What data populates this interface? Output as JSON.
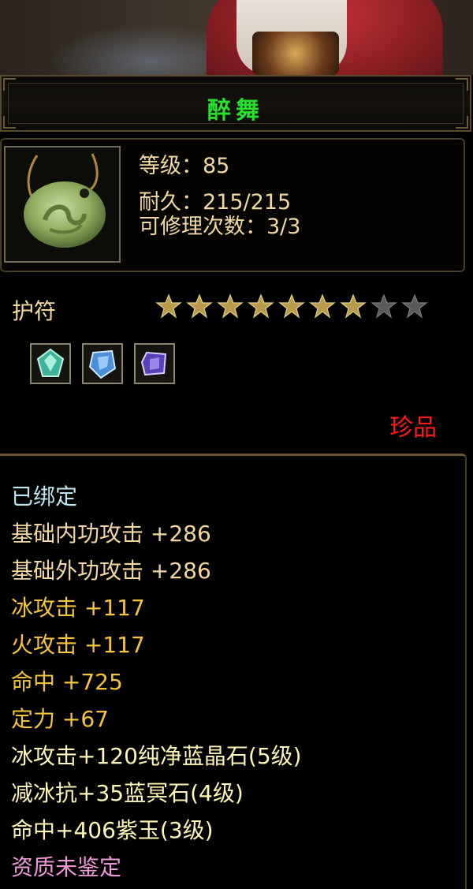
{
  "item": {
    "name": "醉舞",
    "name_color": "#27e02b",
    "stats": [
      {
        "text": "等级：85"
      },
      {
        "text": "耐久：215/215"
      },
      {
        "text": "可修理次数：3/3"
      }
    ],
    "type": "护符",
    "stars": {
      "filled": 7,
      "total": 9
    },
    "gems": [
      {
        "icon": "green-crystal-gem-icon"
      },
      {
        "icon": "blue-crystal-gem-icon"
      },
      {
        "icon": "purple-jade-gem-icon"
      }
    ],
    "rarity": "珍品",
    "rarity_color": "#ff1818"
  },
  "attributes": [
    {
      "text": "已绑定",
      "color": "#bfe6ef"
    },
    {
      "text": "基础内功攻击  +286",
      "color": "#f2d7a0"
    },
    {
      "text": "基础外功攻击  +286",
      "color": "#f2d7a0"
    },
    {
      "text": "冰攻击  +117",
      "color": "#f5c53a"
    },
    {
      "text": "火攻击  +117",
      "color": "#f5c53a"
    },
    {
      "text": "命中  +725",
      "color": "#f5c53a"
    },
    {
      "text": "定力  +67",
      "color": "#f5c53a"
    },
    {
      "text": "冰攻击+120纯净蓝晶石(5级)",
      "color": "#fff6b8"
    },
    {
      "text": "减冰抗+35蓝冥石(4级)",
      "color": "#fff6b8"
    },
    {
      "text": "命中+406紫玉(3级)",
      "color": "#fff6b8"
    },
    {
      "text": "资质未鉴定",
      "color": "#ef9ad8"
    }
  ]
}
